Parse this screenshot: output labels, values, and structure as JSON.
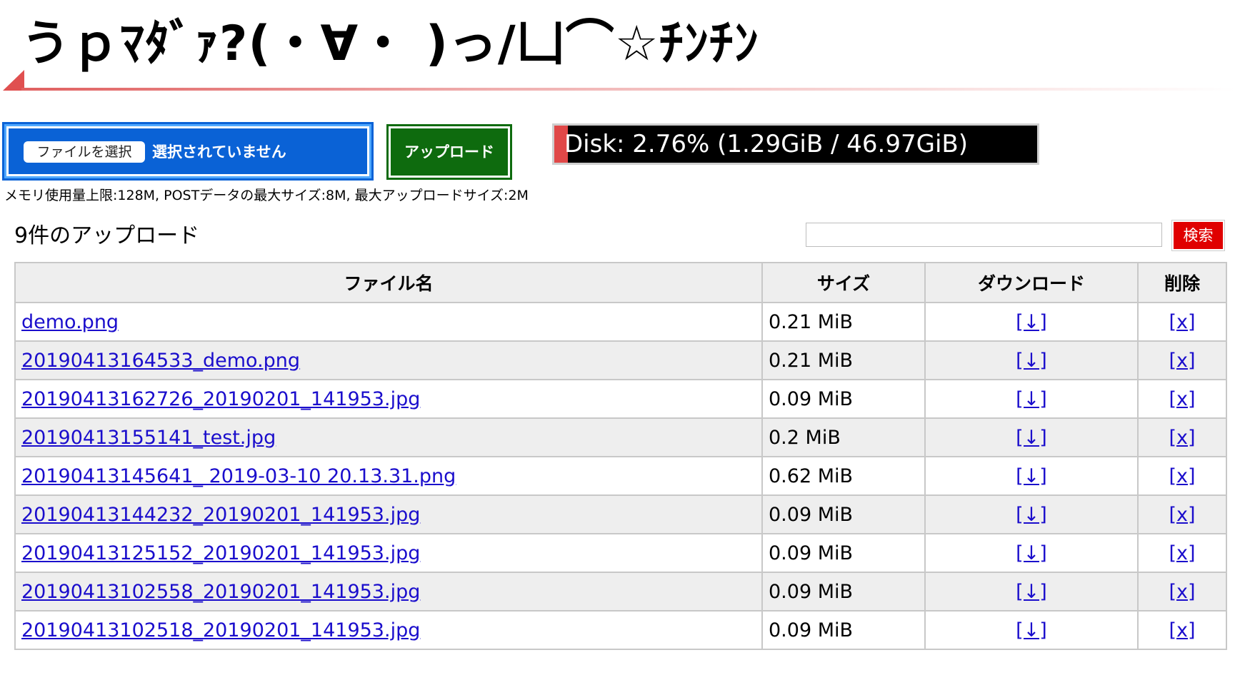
{
  "header": {
    "title": "うｐﾏﾀﾞｧ?(・∀・ )っ/凵⌒☆ﾁﾝﾁﾝ"
  },
  "upload": {
    "choose_label": "ファイルを選択",
    "status_text": "選択されていません",
    "upload_label": "アップロード"
  },
  "disk": {
    "text": "Disk: 2.76% (1.29GiB / 46.97GiB)",
    "percent": 2.76,
    "fill_color": "#e04848",
    "bg_color": "#000000"
  },
  "limits_text": "メモリ使用量上限:128M, POSTデータの最大サイズ:8M, 最大アップロードサイズ:2M",
  "count_text": "9件のアップロード",
  "search": {
    "value": "",
    "placeholder": "",
    "button_label": "検索"
  },
  "table": {
    "headers": {
      "name": "ファイル名",
      "size": "サイズ",
      "download": "ダウンロード",
      "delete": "削除"
    },
    "rows": [
      {
        "name": "demo.png",
        "size": "0.21 MiB",
        "download": "[↓]",
        "delete": "[x]"
      },
      {
        "name": "20190413164533_demo.png",
        "size": "0.21 MiB",
        "download": "[↓]",
        "delete": "[x]"
      },
      {
        "name": "20190413162726_20190201_141953.jpg",
        "size": "0.09 MiB",
        "download": "[↓]",
        "delete": "[x]"
      },
      {
        "name": "20190413155141_test.jpg",
        "size": "0.2 MiB",
        "download": "[↓]",
        "delete": "[x]"
      },
      {
        "name": "20190413145641_ 2019-03-10 20.13.31.png",
        "size": "0.62 MiB",
        "download": "[↓]",
        "delete": "[x]"
      },
      {
        "name": "20190413144232_20190201_141953.jpg",
        "size": "0.09 MiB",
        "download": "[↓]",
        "delete": "[x]"
      },
      {
        "name": "20190413125152_20190201_141953.jpg",
        "size": "0.09 MiB",
        "download": "[↓]",
        "delete": "[x]"
      },
      {
        "name": "20190413102558_20190201_141953.jpg",
        "size": "0.09 MiB",
        "download": "[↓]",
        "delete": "[x]"
      },
      {
        "name": "20190413102518_20190201_141953.jpg",
        "size": "0.09 MiB",
        "download": "[↓]",
        "delete": "[x]"
      }
    ]
  }
}
